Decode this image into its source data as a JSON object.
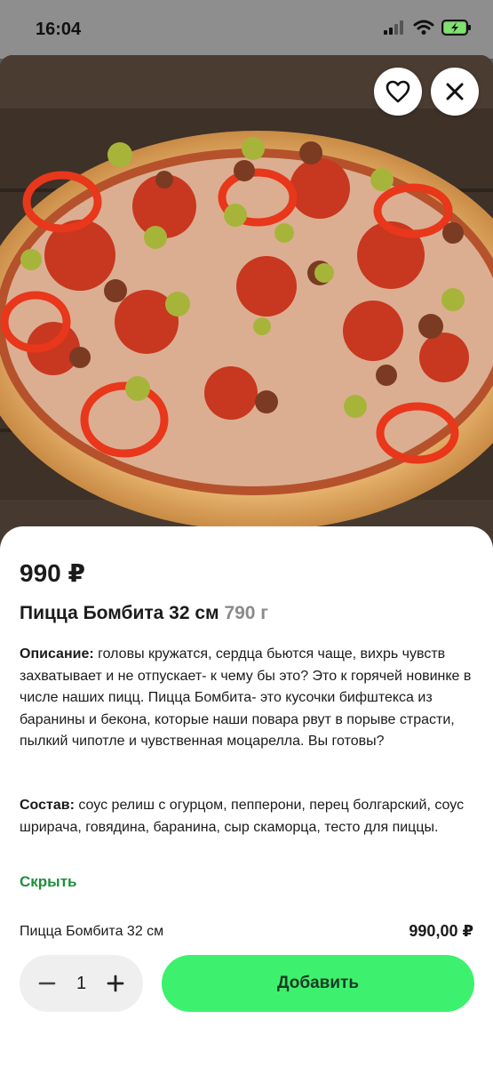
{
  "status": {
    "time": "16:04"
  },
  "product": {
    "price": "990 ₽",
    "name": "Пицца Бомбита 32 см",
    "weight": "790 г",
    "description_label": "Описание:",
    "description": "головы кружатся, сердца бьются чаще, вихрь чувств захватывает и не отпускает- к чему бы это? Это к горячей новинке в числе наших пицц. Пицца Бомбита- это кусочки бифштекса из баранины и бекона, которые наши повара рвут в порыве страсти, пылкий чипотле и чувственная моцарелла. Вы готовы?",
    "composition_label": "Состав:",
    "composition": "соус релиш с огурцом, пепперони, перец болгарский, соус шрирача, говядина, баранина, сыр скаморца, тесто для пиццы.",
    "hide_link": "Скрыть"
  },
  "summary": {
    "name": "Пицца Бомбита 32 см",
    "total": "990,00 ₽"
  },
  "cart": {
    "quantity": "1",
    "add_label": "Добавить"
  },
  "colors": {
    "accent": "#3df16e",
    "link": "#1e8f3c",
    "weight": "#8a8a8a"
  },
  "icons": [
    "heart-icon",
    "close-icon",
    "minus-icon",
    "plus-icon",
    "signal-icon",
    "wifi-icon",
    "battery-charging-icon"
  ]
}
